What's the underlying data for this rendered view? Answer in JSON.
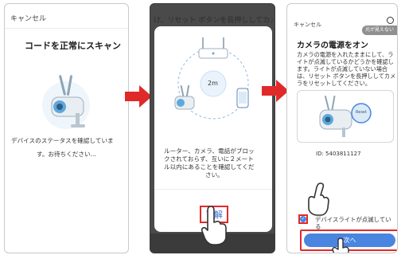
{
  "screen1": {
    "cancel": "キャンセル",
    "title": "コードを正常にスキャン",
    "status_line1": "デバイスのステータスを確認していま",
    "status_line2": "す。お待ちください..."
  },
  "screen2": {
    "background_text": "け、リセット ボタンを長押ししてカメ",
    "distance_label": "2m",
    "message_lines": [
      "ルーター、カメラ、電話がブロッ",
      "クされておらず、互いに２メート",
      "ル以内にあることを確認してくだ",
      "さい。"
    ],
    "ok_button": "了解"
  },
  "screen3": {
    "cancel": "キャンセル",
    "help_badge": "光が見えない",
    "title": "カメラの電源をオン",
    "description_lines": [
      "カメラの電源を入れたままにして、ラ",
      "イトが点滅しているかどうかを確認し",
      "ます。ライトが点滅していない場合",
      "は、リセット ボタンを長押ししてカメ",
      "ラをリセットしてください。"
    ],
    "reset_label": "Reset",
    "device_id": "ID: 5403811127",
    "checkbox_label": "デバイスライトが点滅している",
    "checkbox_checked": true,
    "next_button": "次へ"
  },
  "colors": {
    "accent_blue": "#4a85e0",
    "highlight_red": "#e02a2a",
    "camera_teal": "#5fa8dd"
  }
}
